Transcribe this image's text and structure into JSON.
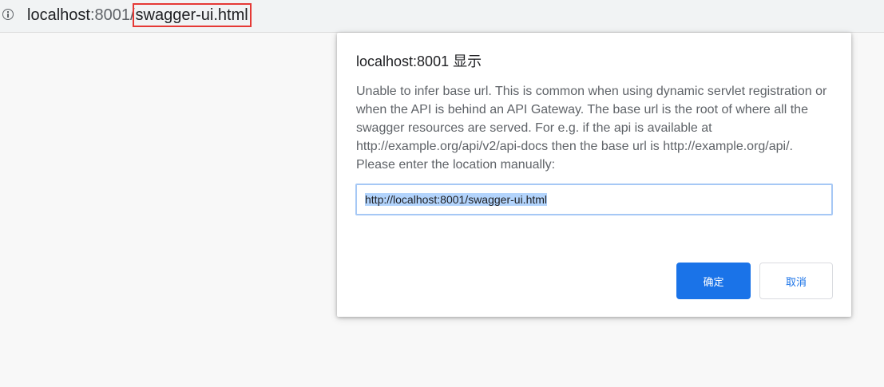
{
  "browser": {
    "url_host": "localhost",
    "url_port": ":8001/",
    "url_path": "swagger-ui.html",
    "info_icon": "info-icon"
  },
  "dialog": {
    "title": "localhost:8001 显示",
    "message": "Unable to infer base url. This is common when using dynamic servlet registration or when the API is behind an API Gateway. The base url is the root of where all the swagger resources are served. For e.g. if the api is available at http://example.org/api/v2/api-docs then the base url is http://example.org/api/. Please enter the location manually:",
    "input_value": "http://localhost:8001/swagger-ui.html",
    "ok_label": "确定",
    "cancel_label": "取消"
  },
  "colors": {
    "accent": "#1a73e8",
    "highlight_box": "#e53935",
    "selection": "#b3d4fc"
  }
}
